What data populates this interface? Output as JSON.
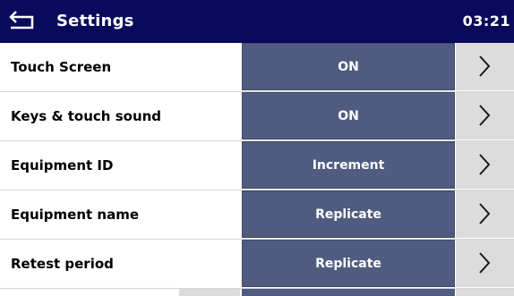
{
  "header": {
    "title": "Settings",
    "time": "03:21",
    "back_icon": "return-arrow-icon"
  },
  "colors": {
    "header_bg": "#0a0a5c",
    "value_button_bg": "#4f5c80",
    "arrow_button_bg": "#dcdcdc"
  },
  "settings": [
    {
      "label": "Touch Screen",
      "value": "ON"
    },
    {
      "label": "Keys & touch sound",
      "value": "ON"
    },
    {
      "label": "Equipment ID",
      "value": "Increment"
    },
    {
      "label": "Equipment name",
      "value": "Replicate"
    },
    {
      "label": "Retest period",
      "value": "Replicate"
    }
  ]
}
